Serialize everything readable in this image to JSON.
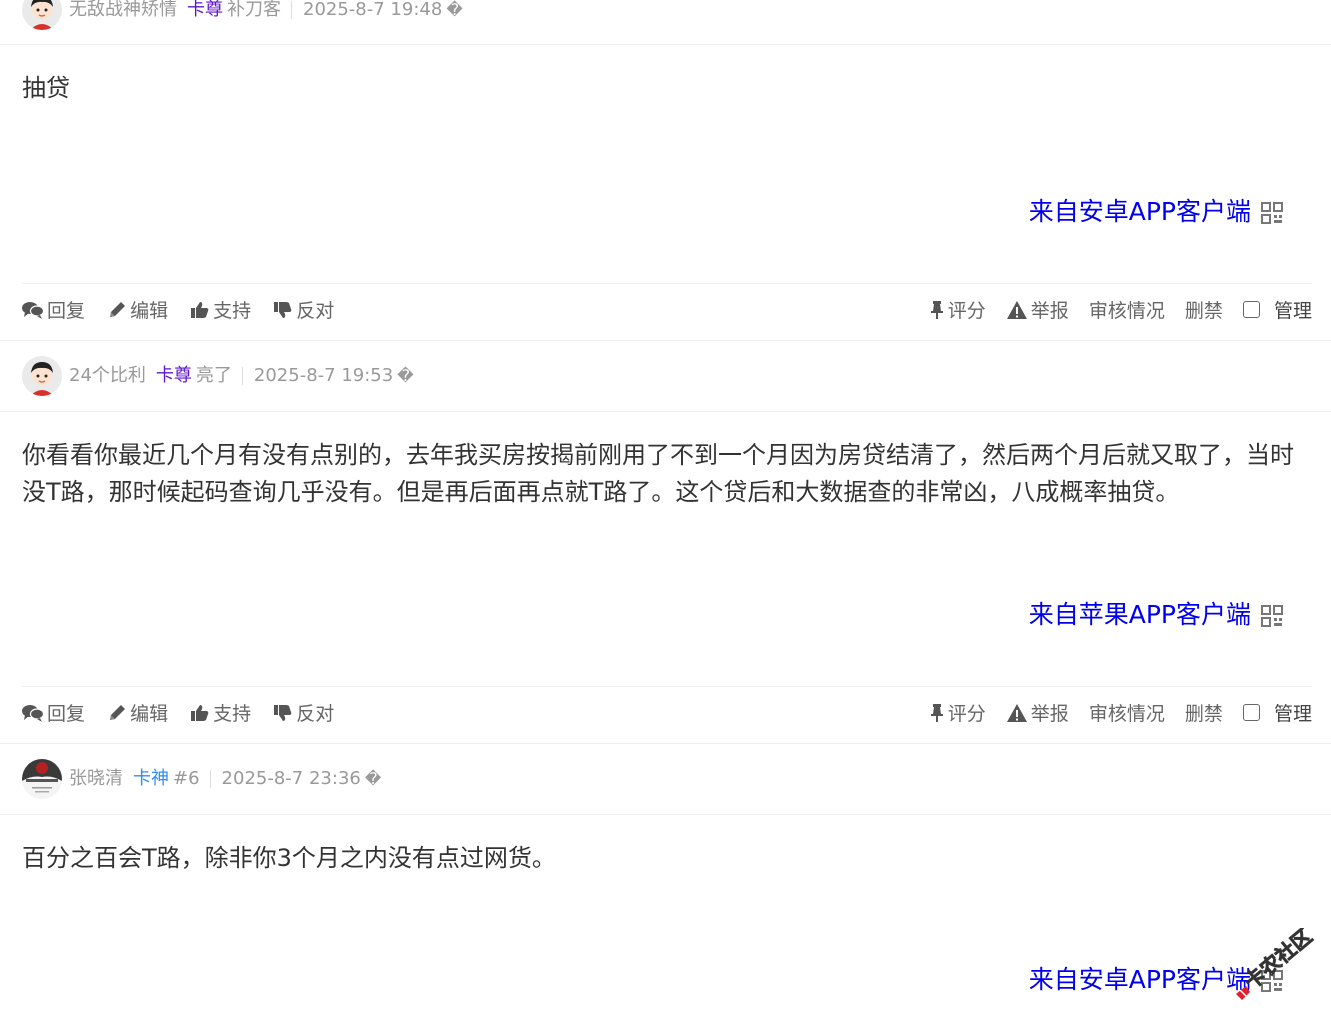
{
  "posts": [
    {
      "username": "无敌战神矫情",
      "rank": "卡尊",
      "title": "补刀客",
      "time": "2025-8-7 19:48",
      "unknown_glyph": "�",
      "content": "抽贷",
      "source": "来自安卓APP客户端"
    },
    {
      "username": "24个比利",
      "rank": "卡尊",
      "title": "亮了",
      "time": "2025-8-7 19:53",
      "unknown_glyph": "�",
      "content": "你看看你最近几个月有没有点别的，去年我买房按揭前刚用了不到一个月因为房贷结清了，然后两个月后就又取了，当时没T路，那时候起码查询几乎没有。但是再后面再点就T路了。这个贷后和大数据查的非常凶，八成概率抽贷。",
      "source": "来自苹果APP客户端"
    },
    {
      "username": "张晓清",
      "rank": "卡神",
      "title": "#6",
      "time": "2025-8-7 23:36",
      "unknown_glyph": "�",
      "content": "百分之百会T路，除非你3个月之内没有点过网货。",
      "source": "来自安卓APP客户端"
    }
  ],
  "actions": {
    "reply": "回复",
    "edit": "编辑",
    "support": "支持",
    "oppose": "反对",
    "rate": "评分",
    "report": "举报",
    "review": "审核情况",
    "ban": "删禁",
    "manage": "管理"
  },
  "watermark": "卡农社区",
  "colors": {
    "link": "#0000ee",
    "rank_purple": "#5c16cc",
    "rank_blue": "#2e8ef5",
    "meta": "#999999",
    "text": "#333333"
  }
}
